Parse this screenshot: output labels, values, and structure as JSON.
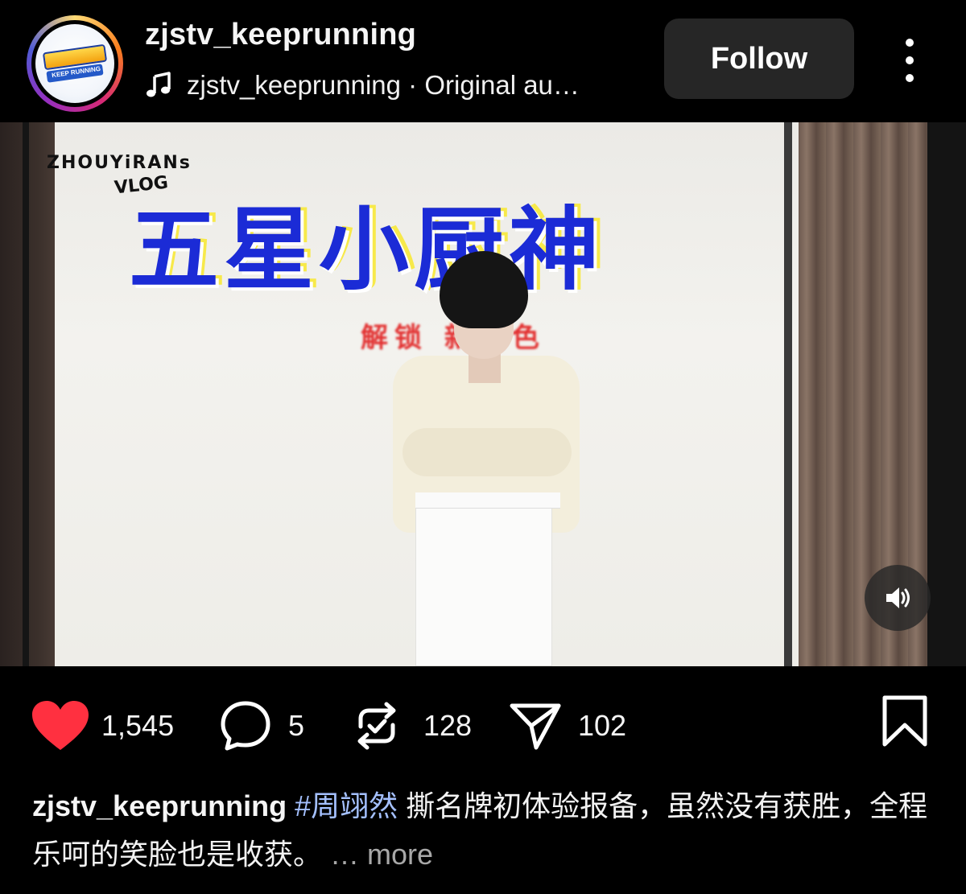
{
  "header": {
    "username": "zjstv_keeprunning",
    "audio_text": "zjstv_keeprunning · Original au…",
    "follow_label": "Follow",
    "avatar_logo_text": "KEEP RUNNING"
  },
  "video": {
    "overlay_tag_line1": "ZHOUYiRANs",
    "overlay_tag_line2": "VLOG",
    "overlay_title": "五星小厨神",
    "overlay_subtitle": "解锁 新角色"
  },
  "actions": {
    "likes": "1,545",
    "comments": "5",
    "reposts": "128",
    "shares": "102"
  },
  "caption": {
    "username": "zjstv_keeprunning",
    "hashtag": "#周翊然",
    "text": " 撕名牌初体验报备，虽然没有获胜，全程乐呵的笑脸也是收获。",
    "more": "… more"
  },
  "colors": {
    "like_red": "#ff3040",
    "follow_bg": "#262626",
    "hashtag_blue": "#a4c0ff"
  }
}
